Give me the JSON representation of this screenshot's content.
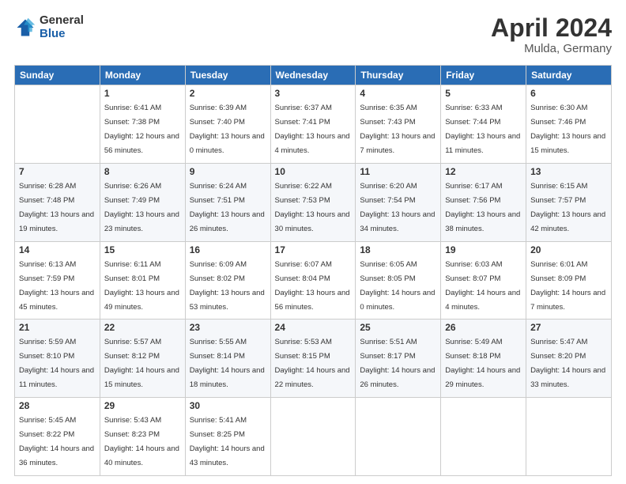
{
  "header": {
    "logo": {
      "general": "General",
      "blue": "Blue"
    },
    "title": "April 2024",
    "location": "Mulda, Germany"
  },
  "weekdays": [
    "Sunday",
    "Monday",
    "Tuesday",
    "Wednesday",
    "Thursday",
    "Friday",
    "Saturday"
  ],
  "weeks": [
    [
      {
        "day": "",
        "sunrise": "",
        "sunset": "",
        "daylight": ""
      },
      {
        "day": "1",
        "sunrise": "Sunrise: 6:41 AM",
        "sunset": "Sunset: 7:38 PM",
        "daylight": "Daylight: 12 hours and 56 minutes."
      },
      {
        "day": "2",
        "sunrise": "Sunrise: 6:39 AM",
        "sunset": "Sunset: 7:40 PM",
        "daylight": "Daylight: 13 hours and 0 minutes."
      },
      {
        "day": "3",
        "sunrise": "Sunrise: 6:37 AM",
        "sunset": "Sunset: 7:41 PM",
        "daylight": "Daylight: 13 hours and 4 minutes."
      },
      {
        "day": "4",
        "sunrise": "Sunrise: 6:35 AM",
        "sunset": "Sunset: 7:43 PM",
        "daylight": "Daylight: 13 hours and 7 minutes."
      },
      {
        "day": "5",
        "sunrise": "Sunrise: 6:33 AM",
        "sunset": "Sunset: 7:44 PM",
        "daylight": "Daylight: 13 hours and 11 minutes."
      },
      {
        "day": "6",
        "sunrise": "Sunrise: 6:30 AM",
        "sunset": "Sunset: 7:46 PM",
        "daylight": "Daylight: 13 hours and 15 minutes."
      }
    ],
    [
      {
        "day": "7",
        "sunrise": "Sunrise: 6:28 AM",
        "sunset": "Sunset: 7:48 PM",
        "daylight": "Daylight: 13 hours and 19 minutes."
      },
      {
        "day": "8",
        "sunrise": "Sunrise: 6:26 AM",
        "sunset": "Sunset: 7:49 PM",
        "daylight": "Daylight: 13 hours and 23 minutes."
      },
      {
        "day": "9",
        "sunrise": "Sunrise: 6:24 AM",
        "sunset": "Sunset: 7:51 PM",
        "daylight": "Daylight: 13 hours and 26 minutes."
      },
      {
        "day": "10",
        "sunrise": "Sunrise: 6:22 AM",
        "sunset": "Sunset: 7:53 PM",
        "daylight": "Daylight: 13 hours and 30 minutes."
      },
      {
        "day": "11",
        "sunrise": "Sunrise: 6:20 AM",
        "sunset": "Sunset: 7:54 PM",
        "daylight": "Daylight: 13 hours and 34 minutes."
      },
      {
        "day": "12",
        "sunrise": "Sunrise: 6:17 AM",
        "sunset": "Sunset: 7:56 PM",
        "daylight": "Daylight: 13 hours and 38 minutes."
      },
      {
        "day": "13",
        "sunrise": "Sunrise: 6:15 AM",
        "sunset": "Sunset: 7:57 PM",
        "daylight": "Daylight: 13 hours and 42 minutes."
      }
    ],
    [
      {
        "day": "14",
        "sunrise": "Sunrise: 6:13 AM",
        "sunset": "Sunset: 7:59 PM",
        "daylight": "Daylight: 13 hours and 45 minutes."
      },
      {
        "day": "15",
        "sunrise": "Sunrise: 6:11 AM",
        "sunset": "Sunset: 8:01 PM",
        "daylight": "Daylight: 13 hours and 49 minutes."
      },
      {
        "day": "16",
        "sunrise": "Sunrise: 6:09 AM",
        "sunset": "Sunset: 8:02 PM",
        "daylight": "Daylight: 13 hours and 53 minutes."
      },
      {
        "day": "17",
        "sunrise": "Sunrise: 6:07 AM",
        "sunset": "Sunset: 8:04 PM",
        "daylight": "Daylight: 13 hours and 56 minutes."
      },
      {
        "day": "18",
        "sunrise": "Sunrise: 6:05 AM",
        "sunset": "Sunset: 8:05 PM",
        "daylight": "Daylight: 14 hours and 0 minutes."
      },
      {
        "day": "19",
        "sunrise": "Sunrise: 6:03 AM",
        "sunset": "Sunset: 8:07 PM",
        "daylight": "Daylight: 14 hours and 4 minutes."
      },
      {
        "day": "20",
        "sunrise": "Sunrise: 6:01 AM",
        "sunset": "Sunset: 8:09 PM",
        "daylight": "Daylight: 14 hours and 7 minutes."
      }
    ],
    [
      {
        "day": "21",
        "sunrise": "Sunrise: 5:59 AM",
        "sunset": "Sunset: 8:10 PM",
        "daylight": "Daylight: 14 hours and 11 minutes."
      },
      {
        "day": "22",
        "sunrise": "Sunrise: 5:57 AM",
        "sunset": "Sunset: 8:12 PM",
        "daylight": "Daylight: 14 hours and 15 minutes."
      },
      {
        "day": "23",
        "sunrise": "Sunrise: 5:55 AM",
        "sunset": "Sunset: 8:14 PM",
        "daylight": "Daylight: 14 hours and 18 minutes."
      },
      {
        "day": "24",
        "sunrise": "Sunrise: 5:53 AM",
        "sunset": "Sunset: 8:15 PM",
        "daylight": "Daylight: 14 hours and 22 minutes."
      },
      {
        "day": "25",
        "sunrise": "Sunrise: 5:51 AM",
        "sunset": "Sunset: 8:17 PM",
        "daylight": "Daylight: 14 hours and 26 minutes."
      },
      {
        "day": "26",
        "sunrise": "Sunrise: 5:49 AM",
        "sunset": "Sunset: 8:18 PM",
        "daylight": "Daylight: 14 hours and 29 minutes."
      },
      {
        "day": "27",
        "sunrise": "Sunrise: 5:47 AM",
        "sunset": "Sunset: 8:20 PM",
        "daylight": "Daylight: 14 hours and 33 minutes."
      }
    ],
    [
      {
        "day": "28",
        "sunrise": "Sunrise: 5:45 AM",
        "sunset": "Sunset: 8:22 PM",
        "daylight": "Daylight: 14 hours and 36 minutes."
      },
      {
        "day": "29",
        "sunrise": "Sunrise: 5:43 AM",
        "sunset": "Sunset: 8:23 PM",
        "daylight": "Daylight: 14 hours and 40 minutes."
      },
      {
        "day": "30",
        "sunrise": "Sunrise: 5:41 AM",
        "sunset": "Sunset: 8:25 PM",
        "daylight": "Daylight: 14 hours and 43 minutes."
      },
      {
        "day": "",
        "sunrise": "",
        "sunset": "",
        "daylight": ""
      },
      {
        "day": "",
        "sunrise": "",
        "sunset": "",
        "daylight": ""
      },
      {
        "day": "",
        "sunrise": "",
        "sunset": "",
        "daylight": ""
      },
      {
        "day": "",
        "sunrise": "",
        "sunset": "",
        "daylight": ""
      }
    ]
  ]
}
